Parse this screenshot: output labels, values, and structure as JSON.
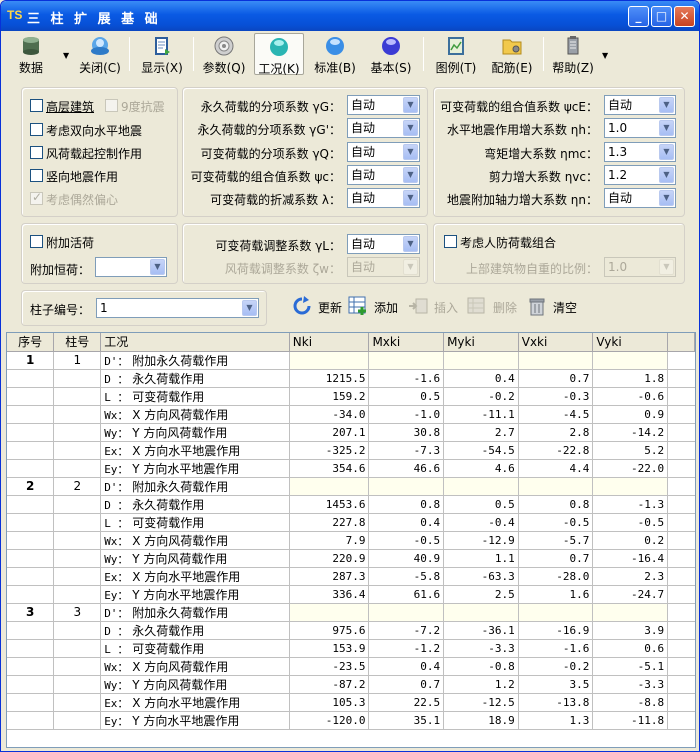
{
  "window": {
    "logo": "TS",
    "title": "三 柱 扩 展 基 础",
    "min": "_",
    "max": "□",
    "close": "✕"
  },
  "toolbar": [
    {
      "id": "data",
      "label": "数据",
      "icon": "database-icon",
      "dropdown": true
    },
    {
      "id": "close",
      "label": "关闭(C)",
      "icon": "close-door-icon"
    },
    {
      "id": "display",
      "label": "显示(X)",
      "icon": "display-icon"
    },
    {
      "id": "params",
      "label": "参数(Q)",
      "icon": "params-icon"
    },
    {
      "id": "cases",
      "label": "工况(K)",
      "icon": "cases-icon",
      "active": true
    },
    {
      "id": "standard",
      "label": "标准(B)",
      "icon": "standard-icon"
    },
    {
      "id": "basic",
      "label": "基本(S)",
      "icon": "basic-icon"
    },
    {
      "id": "legend",
      "label": "图例(T)",
      "icon": "legend-icon"
    },
    {
      "id": "rebar",
      "label": "配筋(E)",
      "icon": "rebar-icon"
    },
    {
      "id": "help",
      "label": "帮助(Z)",
      "icon": "help-icon",
      "dropdown": true
    }
  ],
  "left_checks": [
    {
      "label": "高层建筑",
      "checked": false
    },
    {
      "label": "9度抗震",
      "checked": false,
      "disabled": true
    },
    {
      "label": "考虑双向水平地震",
      "checked": false
    },
    {
      "label": "风荷载起控制作用",
      "checked": false
    },
    {
      "label": "竖向地震作用",
      "checked": false
    },
    {
      "label": "考虑偶然偏心",
      "checked": true,
      "disabled": true
    }
  ],
  "mid_params": [
    {
      "label": "永久荷载的分项系数 γG：",
      "value": "自动"
    },
    {
      "label": "永久荷载的分项系数 γG'：",
      "value": "自动"
    },
    {
      "label": "可变荷载的分项系数 γQ：",
      "value": "自动"
    },
    {
      "label": "可变荷载的组合值系数 ψc：",
      "value": "自动"
    },
    {
      "label": "可变荷载的折减系数 λ：",
      "value": "自动"
    }
  ],
  "right_params": [
    {
      "label": "可变荷载的组合值系数 ψcE：",
      "value": "自动"
    },
    {
      "label": "水平地震作用增大系数 ηh：",
      "value": "1.0"
    },
    {
      "label": "弯矩增大系数 ηmc：",
      "value": "1.3"
    },
    {
      "label": "剪力增大系数 ηvc：",
      "value": "1.2"
    },
    {
      "label": "地震附加轴力增大系数 ηn：",
      "value": "自动"
    }
  ],
  "row2": {
    "live_load_check": "附加活荷",
    "dead_load_label": "附加恒荷：",
    "dead_load_value": "",
    "adjust_label": "可变荷载调整系数 γL：",
    "adjust_value": "自动",
    "wind_adjust_label": "风荷载调整系数 ζw：",
    "wind_adjust_value": "自动",
    "civil_check": "考虑人防荷载组合",
    "ratio_label": "上部建筑物自重的比例：",
    "ratio_value": "1.0"
  },
  "column_select": {
    "label": "柱子编号：",
    "value": "1"
  },
  "actions": [
    {
      "label": "更新",
      "icon": "refresh-icon",
      "enabled": true
    },
    {
      "label": "添加",
      "icon": "add-row-icon",
      "enabled": true
    },
    {
      "label": "插入",
      "icon": "insert-row-icon",
      "enabled": false
    },
    {
      "label": "删除",
      "icon": "delete-row-icon",
      "enabled": false
    },
    {
      "label": "清空",
      "icon": "clear-icon",
      "enabled": true
    }
  ],
  "table": {
    "headers": [
      "序号",
      "柱号",
      "工况",
      "Nki",
      "Mxki",
      "Myki",
      "Vxki",
      "Vyki"
    ],
    "groups": [
      {
        "seq": "1",
        "col": "1",
        "rows": [
          {
            "abbr": "D'：",
            "name": "附加永久荷载作用",
            "v": [
              "",
              "",
              "",
              "",
              ""
            ]
          },
          {
            "abbr": "D ：",
            "name": "永久荷载作用",
            "v": [
              "1215.5",
              "-1.6",
              "0.4",
              "0.7",
              "1.8"
            ]
          },
          {
            "abbr": "L ：",
            "name": "可变荷载作用",
            "v": [
              "159.2",
              "0.5",
              "-0.2",
              "-0.3",
              "-0.6"
            ]
          },
          {
            "abbr": "Wx：",
            "name": "X 方向风荷载作用",
            "v": [
              "-34.0",
              "-1.0",
              "-11.1",
              "-4.5",
              "0.9"
            ]
          },
          {
            "abbr": "Wy：",
            "name": "Y 方向风荷载作用",
            "v": [
              "207.1",
              "30.8",
              "2.7",
              "2.8",
              "-14.2"
            ]
          },
          {
            "abbr": "Ex：",
            "name": "X 方向水平地震作用",
            "v": [
              "-325.2",
              "-7.3",
              "-54.5",
              "-22.8",
              "5.2"
            ]
          },
          {
            "abbr": "Ey：",
            "name": "Y 方向水平地震作用",
            "v": [
              "354.6",
              "46.6",
              "4.6",
              "4.4",
              "-22.0"
            ]
          }
        ]
      },
      {
        "seq": "2",
        "col": "2",
        "rows": [
          {
            "abbr": "D'：",
            "name": "附加永久荷载作用",
            "v": [
              "",
              "",
              "",
              "",
              ""
            ]
          },
          {
            "abbr": "D ：",
            "name": "永久荷载作用",
            "v": [
              "1453.6",
              "0.8",
              "0.5",
              "0.8",
              "-1.3"
            ]
          },
          {
            "abbr": "L ：",
            "name": "可变荷载作用",
            "v": [
              "227.8",
              "0.4",
              "-0.4",
              "-0.5",
              "-0.5"
            ]
          },
          {
            "abbr": "Wx：",
            "name": "X 方向风荷载作用",
            "v": [
              "7.9",
              "-0.5",
              "-12.9",
              "-5.7",
              "0.2"
            ]
          },
          {
            "abbr": "Wy：",
            "name": "Y 方向风荷载作用",
            "v": [
              "220.9",
              "40.9",
              "1.1",
              "0.7",
              "-16.4"
            ]
          },
          {
            "abbr": "Ex：",
            "name": "X 方向水平地震作用",
            "v": [
              "287.3",
              "-5.8",
              "-63.3",
              "-28.0",
              "2.3"
            ]
          },
          {
            "abbr": "Ey：",
            "name": "Y 方向水平地震作用",
            "v": [
              "336.4",
              "61.6",
              "2.5",
              "1.6",
              "-24.7"
            ]
          }
        ]
      },
      {
        "seq": "3",
        "col": "3",
        "rows": [
          {
            "abbr": "D'：",
            "name": "附加永久荷载作用",
            "v": [
              "",
              "",
              "",
              "",
              ""
            ]
          },
          {
            "abbr": "D ：",
            "name": "永久荷载作用",
            "v": [
              "975.6",
              "-7.2",
              "-36.1",
              "-16.9",
              "3.9"
            ]
          },
          {
            "abbr": "L ：",
            "name": "可变荷载作用",
            "v": [
              "153.9",
              "-1.2",
              "-3.3",
              "-1.6",
              "0.6"
            ]
          },
          {
            "abbr": "Wx：",
            "name": "X 方向风荷载作用",
            "v": [
              "-23.5",
              "0.4",
              "-0.8",
              "-0.2",
              "-5.1"
            ]
          },
          {
            "abbr": "Wy：",
            "name": "Y 方向风荷载作用",
            "v": [
              "-87.2",
              "0.7",
              "1.2",
              "3.5",
              "-3.3"
            ]
          },
          {
            "abbr": "Ex：",
            "name": "X 方向水平地震作用",
            "v": [
              "105.3",
              "22.5",
              "-12.5",
              "-13.8",
              "-8.8"
            ]
          },
          {
            "abbr": "Ey：",
            "name": "Y 方向水平地震作用",
            "v": [
              "-120.0",
              "35.1",
              "18.9",
              "1.3",
              "-11.8"
            ]
          }
        ]
      }
    ]
  }
}
